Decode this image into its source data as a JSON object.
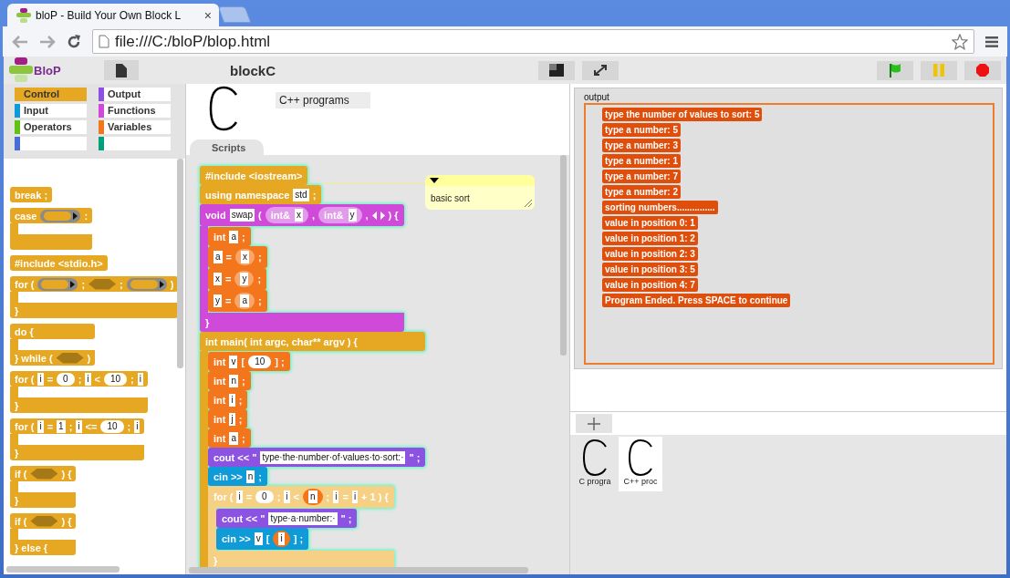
{
  "browser": {
    "tab_title": "bloP - Build Your Own Block L",
    "tab_close": "×",
    "url": "file:///C:/bloP/blop.html"
  },
  "app": {
    "logo_text": "BloP",
    "project_title": "blockC"
  },
  "categories": [
    {
      "label": "Control",
      "color": "#e6a822",
      "selected": true
    },
    {
      "label": "Output",
      "color": "#8f4fe3",
      "selected": false
    },
    {
      "label": "Input",
      "color": "#0f9bd7",
      "selected": false
    },
    {
      "label": "Functions",
      "color": "#cf4ad9",
      "selected": false
    },
    {
      "label": "Operators",
      "color": "#62c213",
      "selected": false
    },
    {
      "label": "Variables",
      "color": "#f3761d",
      "selected": false
    },
    {
      "color": "#4a6cd4",
      "selected": false
    },
    {
      "color": "#00a07a",
      "selected": false
    }
  ],
  "palette": [
    {
      "kind": "plain",
      "color": "#e6a822",
      "parts": [
        {
          "kind": "text",
          "text": "break ;"
        }
      ]
    },
    {
      "kind": "c",
      "color": "#e6a822",
      "parts": [
        {
          "kind": "text",
          "text": "case"
        },
        {
          "kind": "slot"
        },
        {
          "kind": "text",
          "text": ":"
        }
      ]
    },
    {
      "kind": "plain",
      "color": "#e6a822",
      "parts": [
        {
          "kind": "text",
          "text": "#include <stdio.h>"
        }
      ]
    },
    {
      "kind": "c",
      "color": "#e6a822",
      "parts": [
        {
          "kind": "text",
          "text": "for ("
        },
        {
          "kind": "slot"
        },
        {
          "kind": "text",
          "text": ";"
        },
        {
          "kind": "hexagon"
        },
        {
          "kind": "text",
          "text": ";"
        },
        {
          "kind": "slot"
        },
        {
          "kind": "text",
          "text": ")"
        }
      ],
      "close": [
        {
          "kind": "text",
          "text": "}"
        }
      ]
    },
    {
      "kind": "c",
      "color": "#e6a822",
      "parts": [
        {
          "kind": "text",
          "text": "do {"
        }
      ],
      "close": [
        {
          "kind": "text",
          "text": "} while ("
        },
        {
          "kind": "hexagon"
        },
        {
          "kind": "text",
          "text": ")"
        }
      ]
    },
    {
      "kind": "c",
      "color": "#e6a822",
      "parts": [
        {
          "kind": "text",
          "text": "for ("
        },
        {
          "kind": "field",
          "text": "i"
        },
        {
          "kind": "text",
          "text": "="
        },
        {
          "kind": "number",
          "text": "0"
        },
        {
          "kind": "text",
          "text": ";"
        },
        {
          "kind": "field",
          "text": "i"
        },
        {
          "kind": "text",
          "text": "<"
        },
        {
          "kind": "number",
          "text": "10"
        },
        {
          "kind": "text",
          "text": ";"
        },
        {
          "kind": "field",
          "text": "i"
        }
      ],
      "close": [
        {
          "kind": "text",
          "text": "}"
        }
      ]
    },
    {
      "kind": "c",
      "color": "#e6a822",
      "parts": [
        {
          "kind": "text",
          "text": "for ("
        },
        {
          "kind": "field",
          "text": "i"
        },
        {
          "kind": "text",
          "text": "="
        },
        {
          "kind": "field",
          "text": "1"
        },
        {
          "kind": "text",
          "text": ";"
        },
        {
          "kind": "field",
          "text": "i"
        },
        {
          "kind": "text",
          "text": "<="
        },
        {
          "kind": "number",
          "text": "10"
        },
        {
          "kind": "text",
          "text": ";"
        },
        {
          "kind": "field",
          "text": "i"
        }
      ],
      "close": [
        {
          "kind": "text",
          "text": "}"
        }
      ]
    },
    {
      "kind": "c",
      "color": "#e6a822",
      "parts": [
        {
          "kind": "text",
          "text": "if ("
        },
        {
          "kind": "hexagon"
        },
        {
          "kind": "text",
          "text": ") {"
        }
      ],
      "close": [
        {
          "kind": "text",
          "text": "}"
        }
      ]
    },
    {
      "kind": "c",
      "color": "#e6a822",
      "parts": [
        {
          "kind": "text",
          "text": "if ("
        },
        {
          "kind": "hexagon"
        },
        {
          "kind": "text",
          "text": ") {"
        }
      ],
      "close": [
        {
          "kind": "text",
          "text": "} else {"
        }
      ]
    }
  ],
  "sprite": {
    "name": "C++ programs"
  },
  "tabs": [
    {
      "label": "Scripts",
      "selected": true
    }
  ],
  "script": {
    "highlighted": true,
    "blocks": [
      {
        "kind": "plain",
        "color": "#e6a822",
        "parts": [
          {
            "kind": "text",
            "text": "#include <iostream>"
          }
        ]
      },
      {
        "kind": "plain",
        "color": "#e6a822",
        "parts": [
          {
            "kind": "text",
            "text": "using namespace"
          },
          {
            "kind": "field",
            "text": "std"
          },
          {
            "kind": "text",
            "text": ";"
          }
        ]
      },
      {
        "kind": "c",
        "color": "#cf4ad9",
        "parts": [
          {
            "kind": "text",
            "text": "void"
          },
          {
            "kind": "field",
            "text": "swap"
          },
          {
            "kind": "text",
            "text": "("
          },
          {
            "kind": "param",
            "text": "int&",
            "value": "x",
            "color": "#e29aea"
          },
          {
            "kind": "text",
            "text": ","
          },
          {
            "kind": "param",
            "text": "int&",
            "value": "y",
            "color": "#e29aea"
          },
          {
            "kind": "text",
            "text": ","
          },
          {
            "kind": "arrows"
          },
          {
            "kind": "text",
            "text": ") {"
          }
        ],
        "children": [
          {
            "kind": "plain",
            "color": "#f3761d",
            "parts": [
              {
                "kind": "text",
                "text": "int"
              },
              {
                "kind": "field",
                "text": "a"
              },
              {
                "kind": "text",
                "text": ";"
              }
            ]
          },
          {
            "kind": "plain",
            "color": "#f3761d",
            "parts": [
              {
                "kind": "field",
                "text": "a"
              },
              {
                "kind": "text",
                "text": "="
              },
              {
                "kind": "variable",
                "text": "x",
                "color": "#f9a66a"
              },
              {
                "kind": "text",
                "text": ";"
              }
            ]
          },
          {
            "kind": "plain",
            "color": "#f3761d",
            "parts": [
              {
                "kind": "field",
                "text": "x"
              },
              {
                "kind": "text",
                "text": "="
              },
              {
                "kind": "variable",
                "text": "y",
                "color": "#f9a66a"
              },
              {
                "kind": "text",
                "text": ";"
              }
            ]
          },
          {
            "kind": "plain",
            "color": "#f3761d",
            "parts": [
              {
                "kind": "field",
                "text": "y"
              },
              {
                "kind": "text",
                "text": "="
              },
              {
                "kind": "variable",
                "text": "a",
                "color": "#f9a66a"
              },
              {
                "kind": "text",
                "text": ";"
              }
            ]
          }
        ],
        "close": [
          {
            "kind": "text",
            "text": "}"
          }
        ]
      },
      {
        "kind": "c_cut",
        "color": "#e6a822",
        "parts": [
          {
            "kind": "text",
            "text": "int main( int argc, char** argv ) {"
          }
        ],
        "children": [
          {
            "kind": "plain",
            "color": "#f3761d",
            "parts": [
              {
                "kind": "text",
                "text": "int"
              },
              {
                "kind": "field",
                "text": "v"
              },
              {
                "kind": "text",
                "text": "["
              },
              {
                "kind": "number",
                "text": "10"
              },
              {
                "kind": "text",
                "text": "] ;"
              }
            ]
          },
          {
            "kind": "plain",
            "color": "#f3761d",
            "parts": [
              {
                "kind": "text",
                "text": "int"
              },
              {
                "kind": "field",
                "text": "n"
              },
              {
                "kind": "text",
                "text": ";"
              }
            ]
          },
          {
            "kind": "plain",
            "color": "#f3761d",
            "parts": [
              {
                "kind": "text",
                "text": "int"
              },
              {
                "kind": "field",
                "text": "i"
              },
              {
                "kind": "text",
                "text": ";"
              }
            ]
          },
          {
            "kind": "plain",
            "color": "#f3761d",
            "parts": [
              {
                "kind": "text",
                "text": "int"
              },
              {
                "kind": "field",
                "text": "j"
              },
              {
                "kind": "text",
                "text": ";"
              }
            ]
          },
          {
            "kind": "plain",
            "color": "#f3761d",
            "parts": [
              {
                "kind": "text",
                "text": "int"
              },
              {
                "kind": "field",
                "text": "a"
              },
              {
                "kind": "text",
                "text": ";"
              }
            ]
          },
          {
            "kind": "plain",
            "color": "#8c52e2",
            "parts": [
              {
                "kind": "text",
                "text": "cout << \""
              },
              {
                "kind": "field",
                "text": "type·the·number·of·values·to·sort:·"
              },
              {
                "kind": "text",
                "text": "\" ;"
              }
            ]
          },
          {
            "kind": "plain",
            "color": "#0f9bd7",
            "parts": [
              {
                "kind": "text",
                "text": "cin >>"
              },
              {
                "kind": "field",
                "text": "n"
              },
              {
                "kind": "text",
                "text": ";"
              }
            ]
          },
          {
            "kind": "c",
            "color": "#f6d084",
            "parts": [
              {
                "kind": "text",
                "text": "for ("
              },
              {
                "kind": "field",
                "text": "i"
              },
              {
                "kind": "text",
                "text": "="
              },
              {
                "kind": "number",
                "text": "0"
              },
              {
                "kind": "text",
                "text": ";"
              },
              {
                "kind": "field",
                "text": "i"
              },
              {
                "kind": "text",
                "text": "<"
              },
              {
                "kind": "variable",
                "text": "n",
                "color": "#f3761d"
              },
              {
                "kind": "text",
                "text": ";"
              },
              {
                "kind": "field",
                "text": "i"
              },
              {
                "kind": "text",
                "text": "="
              },
              {
                "kind": "field",
                "text": "i"
              },
              {
                "kind": "text",
                "text": "+ 1 ) {"
              }
            ],
            "children": [
              {
                "kind": "plain",
                "color": "#8c52e2",
                "parts": [
                  {
                    "kind": "text",
                    "text": "cout << \""
                  },
                  {
                    "kind": "field",
                    "text": "type·a·number:·"
                  },
                  {
                    "kind": "text",
                    "text": "\" ;"
                  }
                ]
              },
              {
                "kind": "plain",
                "color": "#0f9bd7",
                "parts": [
                  {
                    "kind": "text",
                    "text": "cin >>"
                  },
                  {
                    "kind": "field",
                    "text": "v"
                  },
                  {
                    "kind": "text",
                    "text": "["
                  },
                  {
                    "kind": "variable",
                    "text": "i",
                    "color": "#f3761d"
                  },
                  {
                    "kind": "text",
                    "text": "] ;"
                  }
                ]
              }
            ],
            "close": [
              {
                "kind": "text",
                "text": "}"
              }
            ]
          }
        ]
      }
    ]
  },
  "comment": {
    "text": "basic sort"
  },
  "stage": {
    "label": "output",
    "lines": [
      "type the number of values to sort: 5",
      "type a number: 5",
      "type a number: 3",
      "type a number: 1",
      "type a number: 7",
      "type a number: 2",
      "sorting numbers...............",
      "value in position 0: 1",
      "value in position 1: 2",
      "value in position 2: 3",
      "value in position 3: 5",
      "value in position 4: 7",
      "Program Ended. Press SPACE to continue"
    ]
  },
  "corral": [
    {
      "label": "C progra",
      "selected": false
    },
    {
      "label": "C++ proc",
      "selected": true
    }
  ]
}
